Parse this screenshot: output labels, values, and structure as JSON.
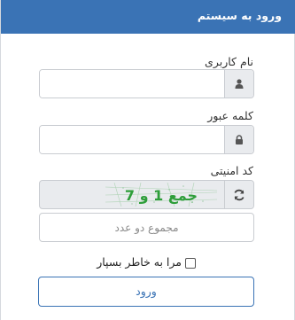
{
  "header": {
    "title": "ورود به سیستم"
  },
  "form": {
    "username": {
      "label": "نام کاربری",
      "value": "",
      "icon": "user-icon"
    },
    "password": {
      "label": "کلمه عبور",
      "value": "",
      "icon": "lock-icon"
    },
    "captcha": {
      "label": "کد امنیتی",
      "image_text": "جمع 1 و 7",
      "refresh_icon": "refresh-icon",
      "answer_placeholder": "مجموع دو عدد"
    },
    "remember_me": {
      "label": "مرا به خاطر بسپار",
      "checked": false
    },
    "submit_label": "ورود"
  },
  "colors": {
    "header_bg": "#3a73b5",
    "accent": "#3a73b5",
    "captcha_text": "#2e9e3a"
  }
}
